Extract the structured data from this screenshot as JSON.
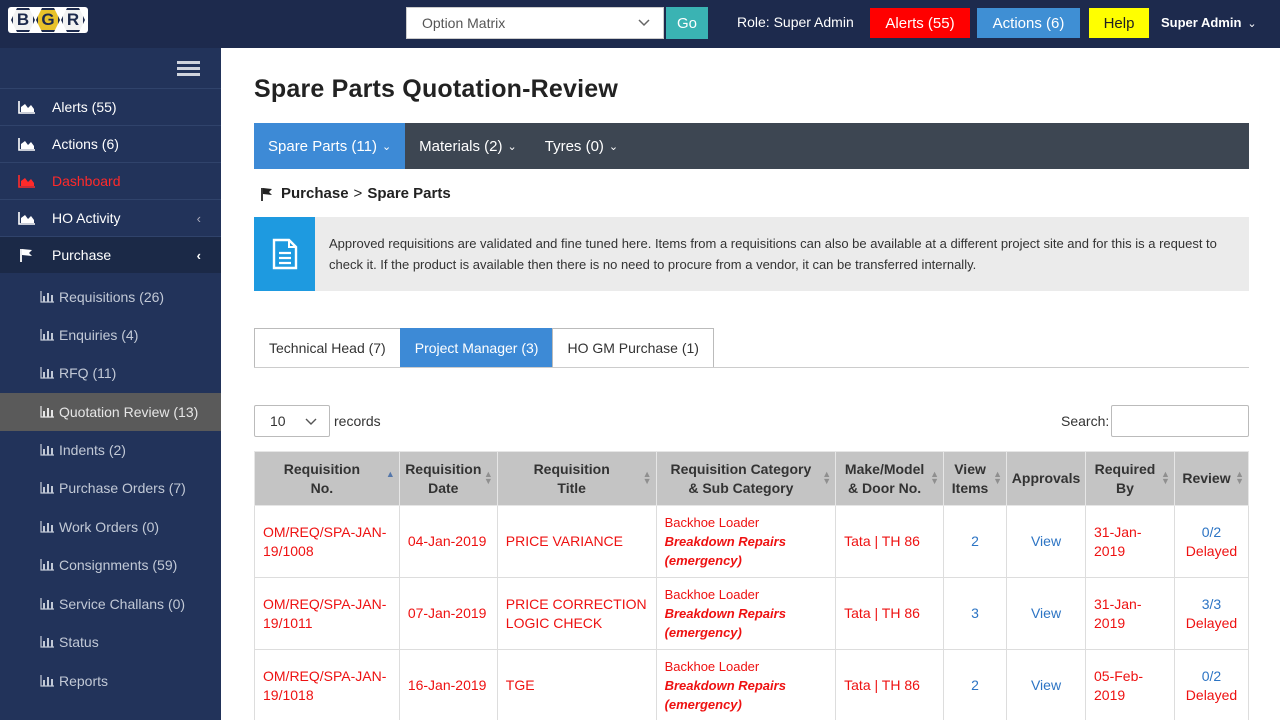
{
  "app": {
    "logo_letters": [
      "B",
      "G",
      "R"
    ],
    "top_select": "Option Matrix",
    "go_label": "Go",
    "role_text": "Role: Super Admin",
    "alerts_label": "Alerts (55)",
    "actions_label": "Actions (6)",
    "help_label": "Help",
    "user_label": "Super Admin"
  },
  "sidebar": {
    "items": [
      {
        "label": "Alerts (55)"
      },
      {
        "label": "Actions (6)"
      },
      {
        "label": "Dashboard"
      },
      {
        "label": "HO Activity"
      },
      {
        "label": "Purchase"
      }
    ],
    "sub_items": [
      {
        "label": "Requisitions (26)"
      },
      {
        "label": "Enquiries (4)"
      },
      {
        "label": "RFQ (11)"
      },
      {
        "label": "Quotation Review (13)"
      },
      {
        "label": "Indents (2)"
      },
      {
        "label": "Purchase Orders (7)"
      },
      {
        "label": "Work Orders (0)"
      },
      {
        "label": "Consignments (59)"
      },
      {
        "label": "Service Challans (0)"
      },
      {
        "label": "Status"
      },
      {
        "label": "Reports"
      }
    ]
  },
  "main": {
    "title": "Spare Parts Quotation-Review",
    "tabs": [
      {
        "label": "Spare Parts (11)"
      },
      {
        "label": "Materials (2)"
      },
      {
        "label": "Tyres (0)"
      }
    ],
    "breadcrumb": {
      "root": "Purchase",
      "separator": ">",
      "current": "Spare Parts"
    },
    "info_text": "Approved requisitions are validated and fine tuned here. Items from a requisitions can also be available at a different project site and for this is a request to check it. If the product is available then there is no need to procure from a vendor, it can be transferred internally.",
    "sub_tabs": [
      {
        "label": "Technical Head (7)"
      },
      {
        "label": "Project Manager (3)"
      },
      {
        "label": "HO GM Purchase (1)"
      }
    ],
    "page_length": "10",
    "records_label": "records",
    "search_label": "Search:",
    "search_value": ""
  },
  "table": {
    "headers": [
      [
        "Requisition",
        "No."
      ],
      [
        "Requisition",
        "Date"
      ],
      [
        "Requisition",
        "Title"
      ],
      [
        "Requisition Category",
        "& Sub Category"
      ],
      [
        "Make/Model",
        "& Door No."
      ],
      [
        "View",
        "Items"
      ],
      [
        "Approvals",
        ""
      ],
      [
        "Required",
        "By"
      ],
      [
        "Review",
        ""
      ]
    ],
    "rows": [
      {
        "no": [
          "OM/REQ/SPA-JAN-",
          "19/1008"
        ],
        "date": "04-Jan-2019",
        "title": [
          "PRICE VARIANCE",
          ""
        ],
        "cat": "Backhoe Loader",
        "subcat": "Breakdown Repairs",
        "priority": "(emergency)",
        "make": "Tata | TH 86",
        "items": "2",
        "approvals": "View",
        "required": [
          "31-Jan-",
          "2019"
        ],
        "review": "0/2",
        "status": "Delayed"
      },
      {
        "no": [
          "OM/REQ/SPA-JAN-",
          "19/1011"
        ],
        "date": "07-Jan-2019",
        "title": [
          "PRICE CORRECTION",
          "LOGIC CHECK"
        ],
        "cat": "Backhoe Loader",
        "subcat": "Breakdown Repairs",
        "priority": "(emergency)",
        "make": "Tata | TH 86",
        "items": "3",
        "approvals": "View",
        "required": [
          "31-Jan-",
          "2019"
        ],
        "review": "3/3",
        "status": "Delayed"
      },
      {
        "no": [
          "OM/REQ/SPA-JAN-",
          "19/1018"
        ],
        "date": "16-Jan-2019",
        "title": [
          "TGE",
          ""
        ],
        "cat": "Backhoe Loader",
        "subcat": "Breakdown Repairs",
        "priority": "(emergency)",
        "make": "Tata | TH 86",
        "items": "2",
        "approvals": "View",
        "required": [
          "05-Feb-",
          "2019"
        ],
        "review": "0/2",
        "status": "Delayed"
      }
    ]
  },
  "colors": {
    "topbar": "#1d2a4d",
    "sidebar": "#22335a",
    "accent_blue": "#3d8ad6",
    "alert_red": "#ff0000",
    "help_yellow": "#ffff00",
    "go_teal": "#3ab3b3",
    "info_blue": "#1e9ae0"
  },
  "icons": {
    "sidebar_chart": "area-chart-icon",
    "purchase": "flag-icon",
    "sub_item": "bar-chart-icon",
    "menu": "hamburger-icon",
    "info": "document-icon"
  }
}
